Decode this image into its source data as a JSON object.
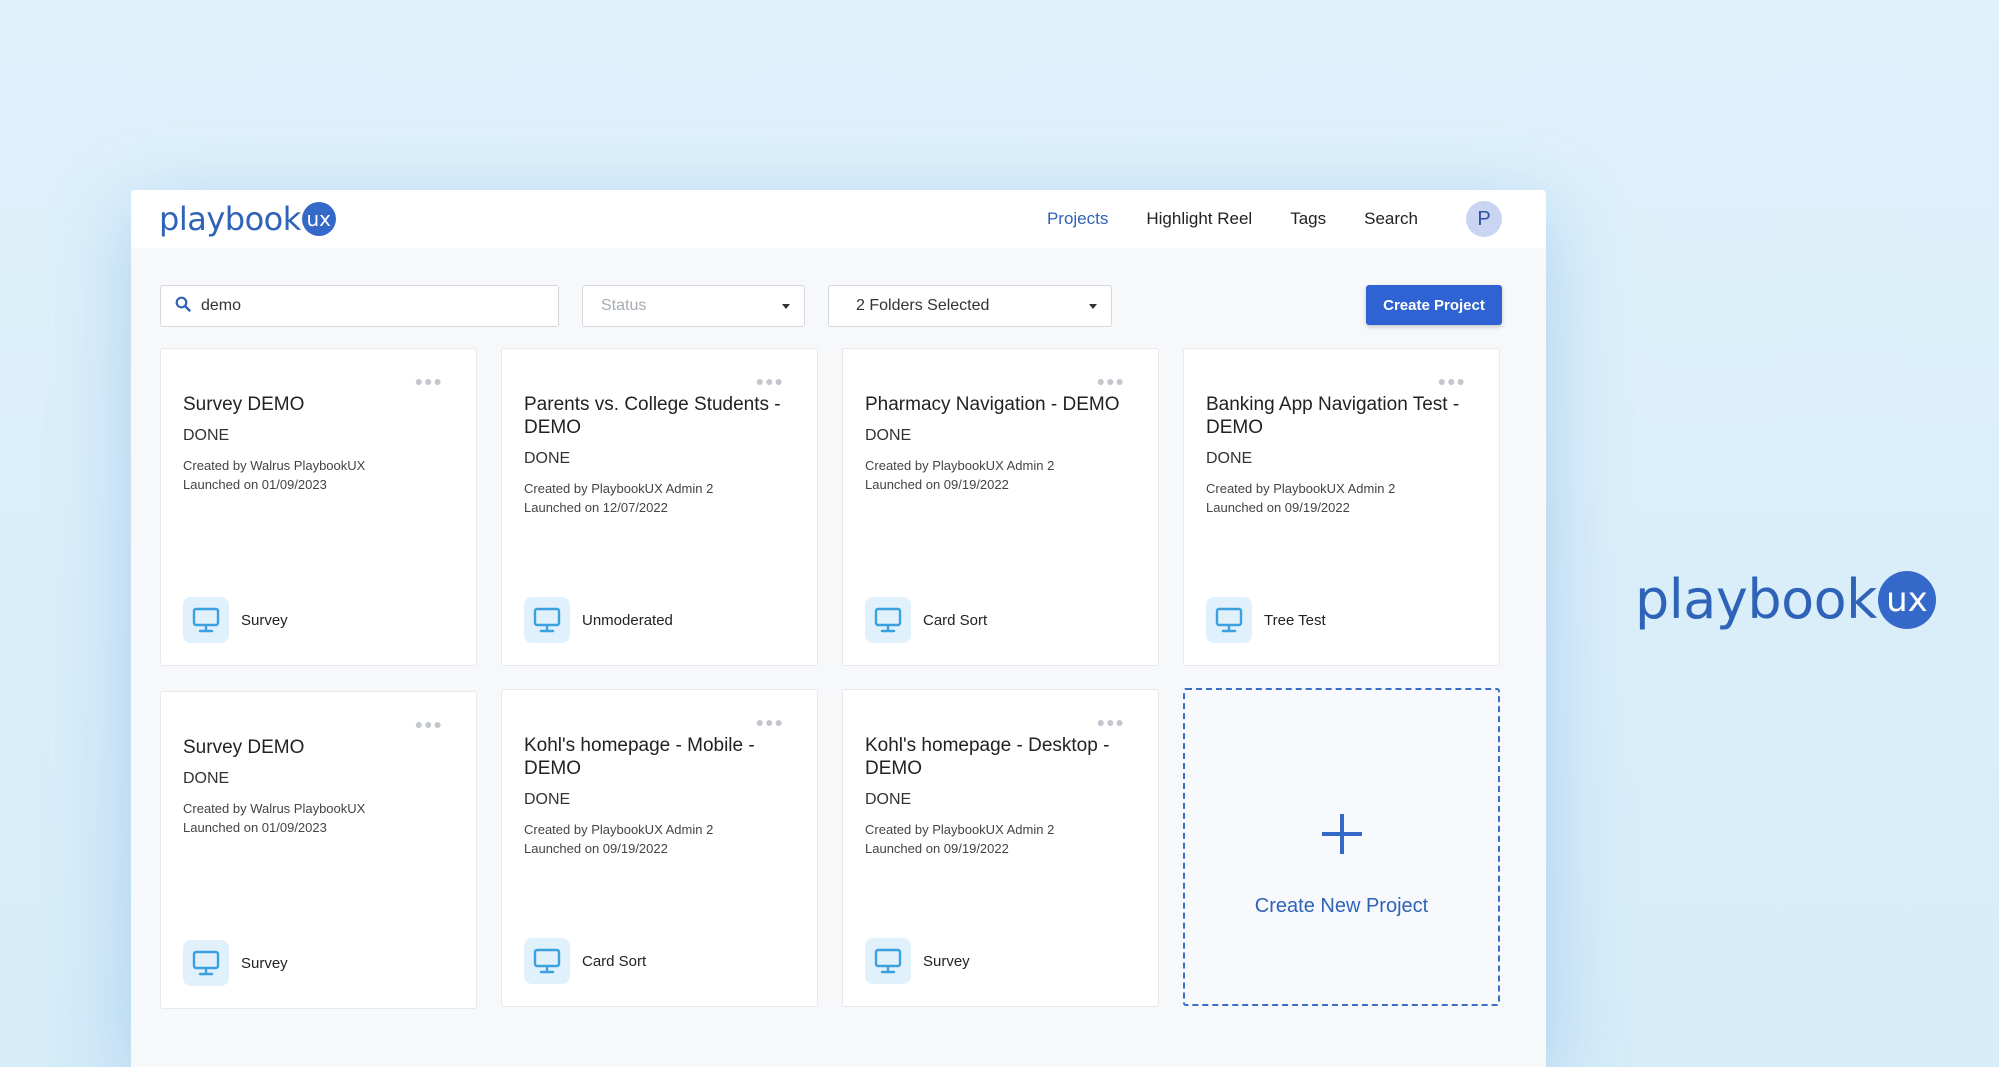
{
  "brand": {
    "logo_text": "playbook",
    "logo_badge": "ux"
  },
  "nav": {
    "items": [
      {
        "label": "Projects",
        "active": true
      },
      {
        "label": "Highlight Reel",
        "active": false
      },
      {
        "label": "Tags",
        "active": false
      },
      {
        "label": "Search",
        "active": false
      }
    ],
    "avatar_initial": "P"
  },
  "toolbar": {
    "search_value": "demo",
    "search_icon": "search-icon",
    "status_placeholder": "Status",
    "folders_label": "2 Folders Selected",
    "create_label": "Create Project"
  },
  "projects": [
    {
      "title": "Survey DEMO",
      "status": "DONE",
      "created_by": "Created by Walrus PlaybookUX",
      "launched": "Launched on 01/09/2023",
      "type": "Survey",
      "icon": "monitor-icon"
    },
    {
      "title": "Parents vs. College Students - DEMO",
      "status": "DONE",
      "created_by": "Created by PlaybookUX Admin 2",
      "launched": "Launched on 12/07/2022",
      "type": "Unmoderated",
      "icon": "monitor-icon"
    },
    {
      "title": "Pharmacy Navigation - DEMO",
      "status": "DONE",
      "created_by": "Created by PlaybookUX Admin 2",
      "launched": "Launched on 09/19/2022",
      "type": "Card Sort",
      "icon": "monitor-icon"
    },
    {
      "title": "Banking App Navigation Test - DEMO",
      "status": "DONE",
      "created_by": "Created by PlaybookUX Admin 2",
      "launched": "Launched on 09/19/2022",
      "type": "Tree Test",
      "icon": "monitor-icon"
    },
    {
      "title": "Survey DEMO",
      "status": "DONE",
      "created_by": "Created by Walrus PlaybookUX",
      "launched": "Launched on 01/09/2023",
      "type": "Survey",
      "icon": "monitor-icon"
    },
    {
      "title": "Kohl's homepage - Mobile - DEMO",
      "status": "DONE",
      "created_by": "Created by PlaybookUX Admin 2",
      "launched": "Launched on 09/19/2022",
      "type": "Card Sort",
      "icon": "monitor-icon"
    },
    {
      "title": "Kohl's homepage - Desktop - DEMO",
      "status": "DONE",
      "created_by": "Created by PlaybookUX Admin 2",
      "launched": "Launched on 09/19/2022",
      "type": "Survey",
      "icon": "monitor-icon"
    }
  ],
  "create_card": {
    "label": "Create New Project",
    "icon": "plus-icon"
  },
  "colors": {
    "accent": "#2f63d3",
    "brand": "#2f63b8",
    "background": "#dff1fb"
  }
}
